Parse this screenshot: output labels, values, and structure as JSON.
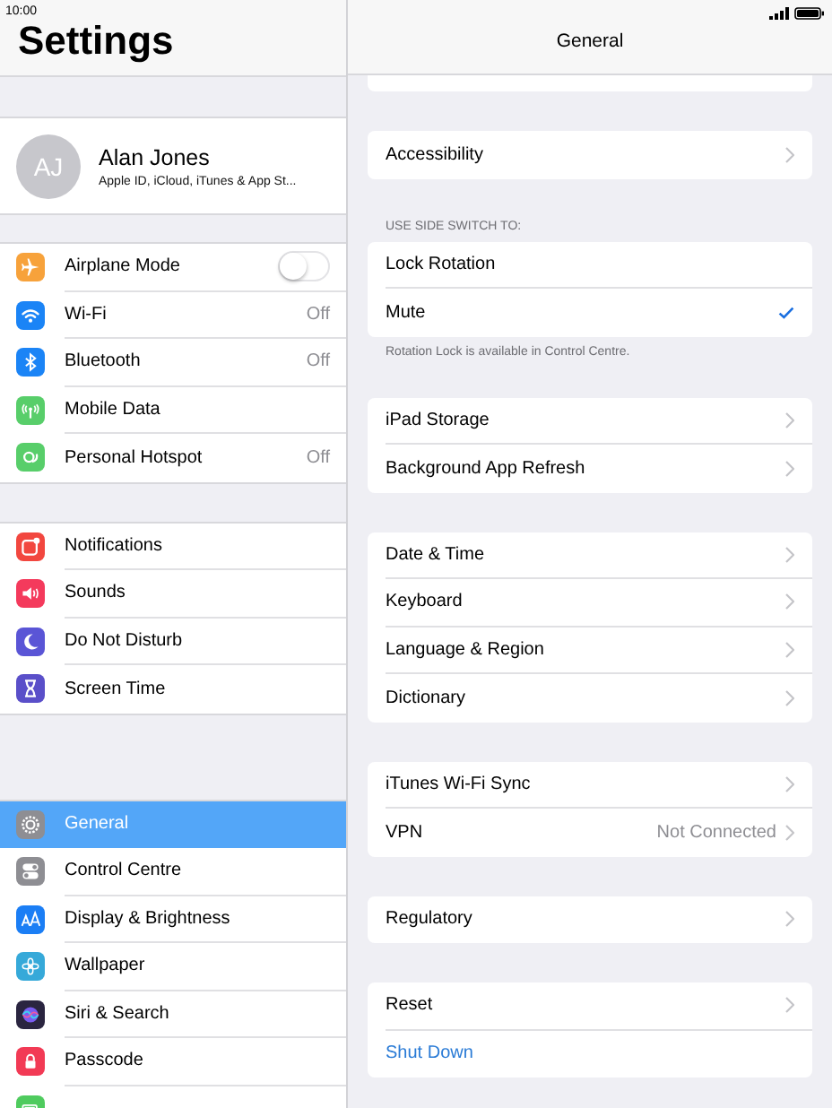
{
  "status_bar": {
    "time": "10:00"
  },
  "sidebar": {
    "title": "Settings",
    "profile": {
      "initials": "AJ",
      "name": "Alan Jones",
      "subtitle": "Apple ID, iCloud, iTunes & App St..."
    },
    "groups": [
      {
        "items": [
          {
            "label": "Airplane Mode",
            "kind": "toggle",
            "on": false,
            "color": "#f7a23b",
            "selected": false
          },
          {
            "label": "Wi-Fi",
            "kind": "value",
            "value": "Off",
            "color": "#1b84f6",
            "selected": false
          },
          {
            "label": "Bluetooth",
            "kind": "value",
            "value": "Off",
            "color": "#1b84f6",
            "selected": false
          },
          {
            "label": "Mobile Data",
            "kind": "plain",
            "color": "#58ce6a",
            "selected": false
          },
          {
            "label": "Personal Hotspot",
            "kind": "value",
            "value": "Off",
            "color": "#58ce6a",
            "selected": false
          }
        ]
      },
      {
        "items": [
          {
            "label": "Notifications",
            "kind": "plain",
            "color": "#f2473f",
            "selected": false
          },
          {
            "label": "Sounds",
            "kind": "plain",
            "color": "#f43a5c",
            "selected": false
          },
          {
            "label": "Do Not Disturb",
            "kind": "plain",
            "color": "#5a55d6",
            "selected": false
          },
          {
            "label": "Screen Time",
            "kind": "plain",
            "color": "#5a4fc9",
            "selected": false
          }
        ]
      },
      {
        "items": [
          {
            "label": "General",
            "kind": "plain",
            "color": "#8e8e93",
            "selected": true
          },
          {
            "label": "Control Centre",
            "kind": "plain",
            "color": "#8e8e93",
            "selected": false
          },
          {
            "label": "Display & Brightness",
            "kind": "plain",
            "color": "#1b7ef5",
            "selected": false
          },
          {
            "label": "Wallpaper",
            "kind": "plain",
            "color": "#36a9d9",
            "selected": false
          },
          {
            "label": "Siri & Search",
            "kind": "plain",
            "color": "#2a2540",
            "selected": false
          },
          {
            "label": "Passcode",
            "kind": "plain",
            "color": "#f23a55",
            "selected": false
          },
          {
            "kind": "plain",
            "color": "#4fcb5e",
            "selected": false
          }
        ]
      }
    ]
  },
  "detail": {
    "title": "General",
    "groups": [
      {
        "rows": [
          {
            "label": "Accessibility",
            "kind": "nav"
          }
        ]
      },
      {
        "header": "USE SIDE SWITCH TO:",
        "footer": "Rotation Lock is available in Control Centre.",
        "rows": [
          {
            "label": "Lock Rotation",
            "kind": "option",
            "checked": false
          },
          {
            "label": "Mute",
            "kind": "option",
            "checked": true
          }
        ]
      },
      {
        "rows": [
          {
            "label": "iPad Storage",
            "kind": "nav"
          },
          {
            "label": "Background App Refresh",
            "kind": "nav"
          }
        ]
      },
      {
        "rows": [
          {
            "label": "Date & Time",
            "kind": "nav"
          },
          {
            "label": "Keyboard",
            "kind": "nav"
          },
          {
            "label": "Language & Region",
            "kind": "nav"
          },
          {
            "label": "Dictionary",
            "kind": "nav"
          }
        ]
      },
      {
        "rows": [
          {
            "label": "iTunes Wi-Fi Sync",
            "kind": "nav"
          },
          {
            "label": "VPN",
            "kind": "nav",
            "value": "Not Connected"
          }
        ]
      },
      {
        "rows": [
          {
            "label": "Regulatory",
            "kind": "nav"
          }
        ]
      },
      {
        "rows": [
          {
            "label": "Reset",
            "kind": "nav"
          },
          {
            "label": "Shut Down",
            "kind": "action"
          }
        ]
      }
    ]
  }
}
